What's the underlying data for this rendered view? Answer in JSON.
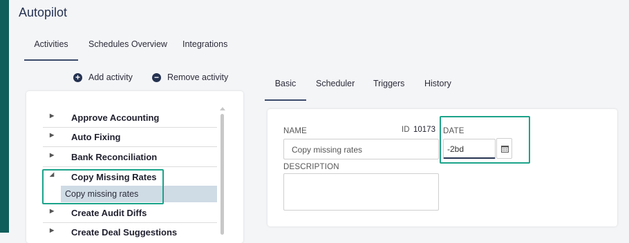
{
  "app": {
    "title": "Autopilot"
  },
  "top_tabs": [
    {
      "label": "Activities",
      "active": true
    },
    {
      "label": "Schedules Overview",
      "active": false
    },
    {
      "label": "Integrations",
      "active": false
    }
  ],
  "actions": {
    "add_label": "Add activity",
    "remove_label": "Remove activity"
  },
  "activities": [
    {
      "label": "Approve Accounting",
      "expanded": false
    },
    {
      "label": "Auto Fixing",
      "expanded": false
    },
    {
      "label": "Bank Reconciliation",
      "expanded": false
    },
    {
      "label": "Copy Missing Rates",
      "expanded": true
    },
    {
      "label": "Create Audit Diffs",
      "expanded": false
    },
    {
      "label": "Create Deal Suggestions",
      "expanded": false
    }
  ],
  "selected_child": {
    "label": "Copy missing rates"
  },
  "detail_tabs": [
    {
      "label": "Basic",
      "active": true
    },
    {
      "label": "Scheduler",
      "active": false
    },
    {
      "label": "Triggers",
      "active": false
    },
    {
      "label": "History",
      "active": false
    }
  ],
  "form": {
    "name_label": "NAME",
    "name_value": "Copy missing rates",
    "id_label": "ID",
    "id_value": "10173",
    "date_label": "DATE",
    "date_value": "-2bd",
    "description_label": "DESCRIPTION",
    "description_value": ""
  },
  "colors": {
    "sidebar": "#0f5e5b",
    "highlight": "#1aa38a",
    "accent": "#253250",
    "selected_row": "#cfdbe5"
  }
}
